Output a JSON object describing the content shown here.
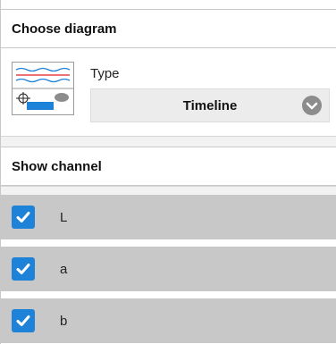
{
  "diagram": {
    "title": "Choose diagram",
    "type_label": "Type",
    "type_value": "Timeline"
  },
  "channels": {
    "title": "Show channel",
    "items": [
      {
        "label": "L",
        "checked": true
      },
      {
        "label": "a",
        "checked": true
      },
      {
        "label": "b",
        "checked": true
      }
    ]
  },
  "colors": {
    "checkbox": "#1e82d8",
    "row_bg": "#c8c8c8",
    "select_bg": "#ececec",
    "chevron_bg": "#8c8c8c"
  },
  "icons": {
    "thumbnail": "timeline-diagram-icon",
    "select": "chevron-down-icon",
    "check": "checkmark-icon"
  }
}
